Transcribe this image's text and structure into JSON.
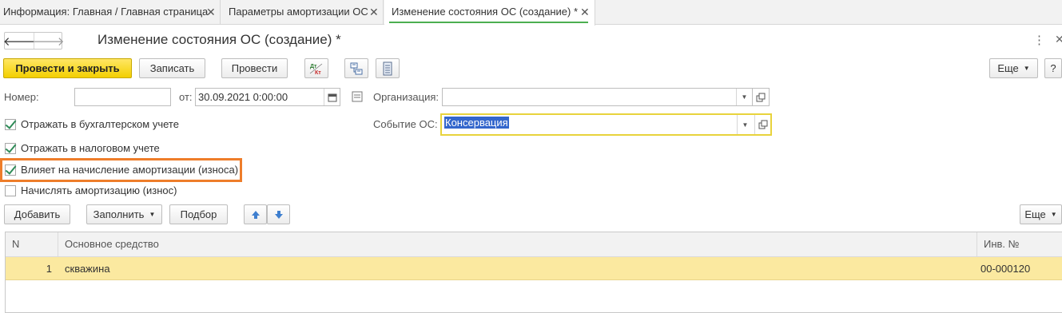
{
  "tabs": [
    {
      "label": "Информация: Главная / Главная страница"
    },
    {
      "label": "Параметры амортизации ОС"
    },
    {
      "label": "Изменение состояния ОС (создание) *"
    }
  ],
  "header": {
    "title": "Изменение состояния ОС (создание) *"
  },
  "toolbar": {
    "post_close_label": "Провести и закрыть",
    "save_label": "Записать",
    "post_label": "Провести",
    "dtkt_icon_label": "Дт Кт",
    "more_label": "Еще",
    "help_label": "?"
  },
  "form": {
    "number_label": "Номер:",
    "number_value": "",
    "date_label": "от:",
    "date_value": "30.09.2021  0:00:00",
    "organization_label": "Организация:",
    "organization_value": "",
    "event_label": "Событие ОС:",
    "event_value": "Консервация"
  },
  "checkboxes": [
    {
      "label": "Отражать в бухгалтерском учете",
      "checked": true
    },
    {
      "label": "Отражать в налоговом учете",
      "checked": true
    },
    {
      "label": "Влияет на начисление амортизации (износа)",
      "checked": true
    },
    {
      "label": "Начислять амортизацию (износ)",
      "checked": false
    }
  ],
  "table_toolbar": {
    "add_label": "Добавить",
    "fill_label": "Заполнить",
    "select_label": "Подбор",
    "more_label": "Еще"
  },
  "table": {
    "columns": [
      "N",
      "Основное средство",
      "Инв. №"
    ],
    "rows": [
      {
        "n": "1",
        "asset": "скважина",
        "inv": "00-000120"
      }
    ]
  },
  "colors": {
    "primary_button": "#f3cf00",
    "highlight_border": "#ee7d2a",
    "selected_row": "#fbe9a0",
    "active_tab_underline": "#4caf50",
    "checkmark": "#2e8b57"
  },
  "icons": [
    "back-arrow-icon",
    "forward-arrow-icon",
    "dtkt-icon",
    "structure-icon",
    "report-icon",
    "calendar-icon",
    "comment-icon",
    "open-icon",
    "arrow-up-icon",
    "arrow-down-icon",
    "more-vert-icon",
    "close-icon"
  ]
}
